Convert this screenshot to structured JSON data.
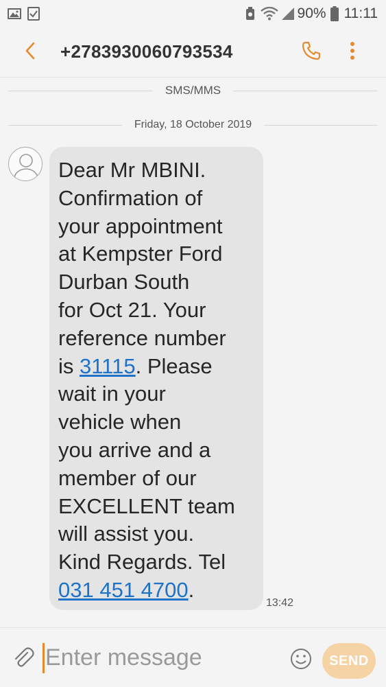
{
  "status_bar": {
    "battery_percent": "90%",
    "time": "11:11"
  },
  "header": {
    "contact": "+2783930060793534"
  },
  "thread": {
    "channel_label": "SMS/MMS",
    "date_label": "Friday, 18 October 2019",
    "message": {
      "part1": "Dear Mr MBINI.\nConfirmation of\nyour appointment\nat Kempster Ford\nDurban South\nfor Oct 21. Your\nreference number\nis ",
      "link_ref": "31115",
      "part2": ". Please\nwait in your\nvehicle when\nyou arrive and a\nmember of our\nEXCELLENT team\nwill assist you.\nKind Regards. Tel\n",
      "link_tel": "031 451 4700",
      "part3": ".",
      "time": "13:42"
    }
  },
  "composer": {
    "placeholder": "Enter message",
    "send_label": "SEND"
  },
  "colors": {
    "accent": "#e48b2f",
    "bubble": "#e4e4e4",
    "link": "#1e72c8",
    "send_button": "#f5d3a5"
  },
  "icons": {
    "status_left": [
      "image-icon",
      "checklist-icon"
    ],
    "status_right": [
      "alarm-icon",
      "wifi-icon",
      "signal-icon",
      "battery-icon"
    ],
    "header": [
      "back-arrow-icon",
      "phone-icon",
      "more-vert-icon"
    ],
    "composer": [
      "paperclip-icon",
      "emoji-icon"
    ]
  }
}
